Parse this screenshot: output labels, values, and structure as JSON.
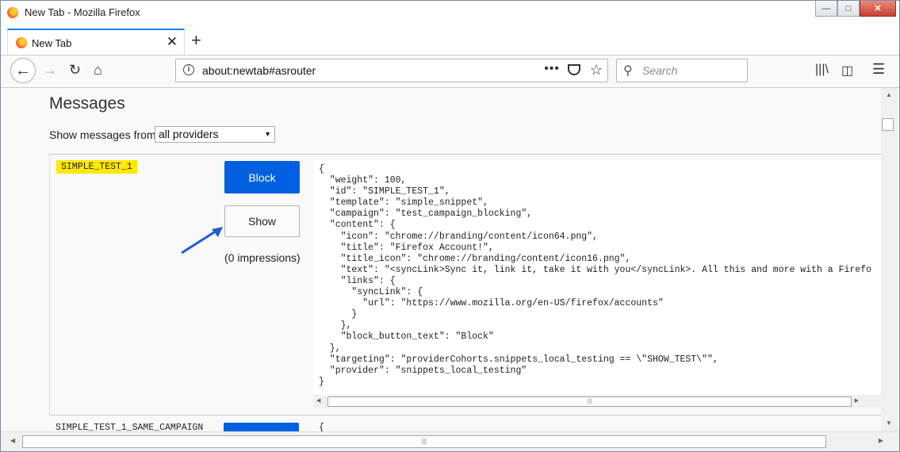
{
  "window": {
    "title": "New Tab - Mozilla Firefox"
  },
  "tabs": [
    {
      "label": "New Tab"
    }
  ],
  "navbar": {
    "url": "about:newtab#asrouter",
    "search_placeholder": "Search"
  },
  "page": {
    "heading": "Messages",
    "provider_label": "Show messages from",
    "provider_selected": "all providers"
  },
  "messages": [
    {
      "id": "SIMPLE_TEST_1",
      "block_label": "Block",
      "show_label": "Show",
      "impressions": "(0 impressions)",
      "json": "{\n  \"weight\": 100,\n  \"id\": \"SIMPLE_TEST_1\",\n  \"template\": \"simple_snippet\",\n  \"campaign\": \"test_campaign_blocking\",\n  \"content\": {\n    \"icon\": \"chrome://branding/content/icon64.png\",\n    \"title\": \"Firefox Account!\",\n    \"title_icon\": \"chrome://branding/content/icon16.png\",\n    \"text\": \"<syncLink>Sync it, link it, take it with you</syncLink>. All this and more with a Firefo\n    \"links\": {\n      \"syncLink\": {\n        \"url\": \"https://www.mozilla.org/en-US/firefox/accounts\"\n      }\n    },\n    \"block_button_text\": \"Block\"\n  },\n  \"targeting\": \"providerCohorts.snippets_local_testing == \\\"SHOW_TEST\\\"\",\n  \"provider\": \"snippets_local_testing\"\n}"
    },
    {
      "id": "SIMPLE_TEST_1_SAME_CAMPAIGN",
      "json_start": "{"
    }
  ],
  "colors": {
    "accent": "#0a84ff",
    "block_button": "#0060df",
    "badge": "#ffe900",
    "annotation_arrow": "#1f5fcf"
  },
  "icons": [
    "firefox-logo-icon",
    "back-icon",
    "forward-icon",
    "reload-icon",
    "home-icon",
    "info-icon",
    "page-actions-icon",
    "pocket-icon",
    "bookmark-star-icon",
    "search-icon",
    "library-icon",
    "sidebar-icon",
    "menu-icon"
  ]
}
